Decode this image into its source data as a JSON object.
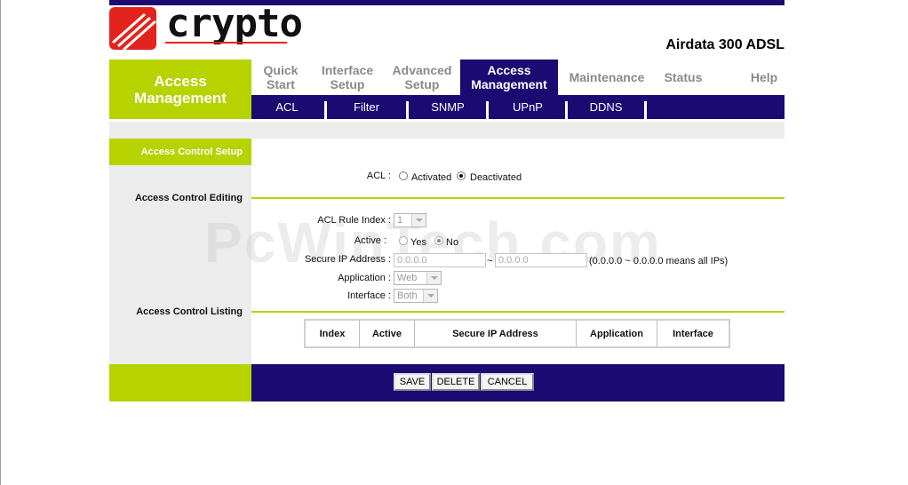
{
  "brand": {
    "logo_text": "crypto",
    "product_name": "Airdata 300 ADSL",
    "color_accent": "#e3231d"
  },
  "colors": {
    "nav_blue": "#1a0a72",
    "lime_green": "#b6d300",
    "grey_panel": "#ececec"
  },
  "section_title": "Access Management",
  "main_nav": [
    {
      "label": "Quick Start"
    },
    {
      "label": "Interface Setup"
    },
    {
      "label": "Advanced Setup"
    },
    {
      "label": "Access Management",
      "active": true
    },
    {
      "label": "Maintenance"
    },
    {
      "label": "Status"
    },
    {
      "label": "Help"
    }
  ],
  "sub_nav": [
    "ACL",
    "Filter",
    "SNMP",
    "UPnP",
    "DDNS"
  ],
  "left_labels": {
    "setup": "Access Control Setup",
    "editing": "Access Control Editing",
    "listing": "Access Control Listing"
  },
  "acl": {
    "label": "ACL :",
    "options": [
      "Activated",
      "Deactivated"
    ],
    "selected": "Deactivated"
  },
  "editing": {
    "rule_index_label": "ACL Rule Index :",
    "rule_index_value": "1",
    "active_label": "Active :",
    "active_options": [
      "Yes",
      "No"
    ],
    "active_selected": "No",
    "secure_ip_label": "Secure IP Address :",
    "ip_from": "0.0.0.0",
    "ip_sep": "~",
    "ip_to": "0.0.0.0",
    "ip_hint": "(0.0.0.0 ~ 0.0.0.0 means all IPs)",
    "application_label": "Application :",
    "application_value": "Web",
    "interface_label": "Interface :",
    "interface_value": "Both"
  },
  "listing_columns": [
    "Index",
    "Active",
    "Secure IP Address",
    "Application",
    "Interface"
  ],
  "buttons": {
    "save": "SAVE",
    "delete": "DELETE",
    "cancel": "CANCEL"
  },
  "watermark": "PcWinTech.com"
}
